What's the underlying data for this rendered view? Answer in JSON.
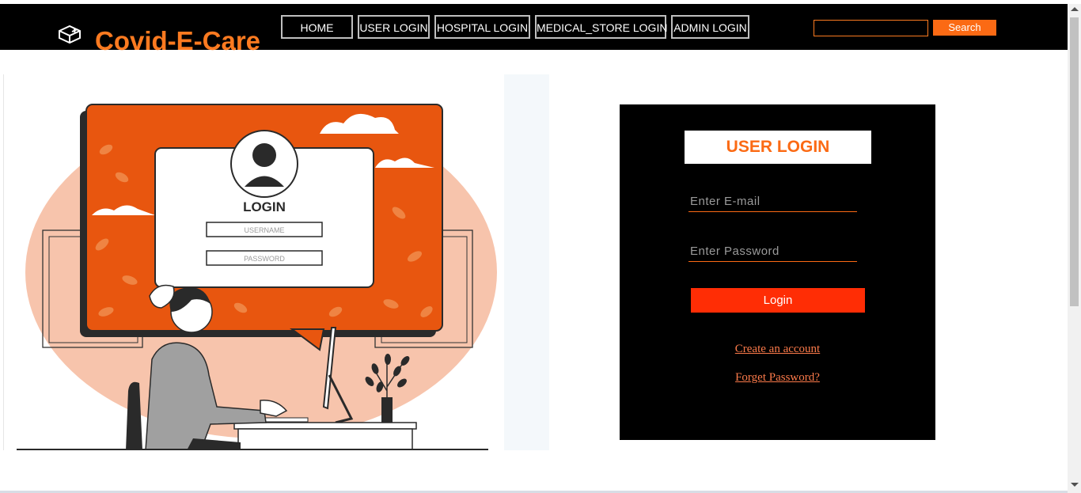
{
  "brand": {
    "name": "Covid-E-Care",
    "logo_icon": "medicine-box-icon"
  },
  "nav": {
    "items": [
      {
        "label": "HOME"
      },
      {
        "label": "USER LOGIN"
      },
      {
        "label": "HOSPITAL LOGIN"
      },
      {
        "label": "MEDICAL_STORE LOGIN"
      },
      {
        "label": "ADMIN LOGIN"
      }
    ]
  },
  "search": {
    "value": "",
    "placeholder": "",
    "button_label": "Search"
  },
  "illustration": {
    "heading": "LOGIN",
    "username_hint": "USERNAME",
    "password_hint": "PASSWORD"
  },
  "login": {
    "title": "USER LOGIN",
    "email_placeholder": "Enter E-mail",
    "password_placeholder": "Enter Password",
    "button_label": "Login",
    "create_account": "Create an account",
    "forgot_password": "Forget Password?"
  },
  "colors": {
    "accent": "#fb6a14",
    "button": "#ff2d05",
    "navbar": "#000000",
    "illustration_orange": "#e8560f",
    "illustration_peach": "#f7c4ac"
  }
}
